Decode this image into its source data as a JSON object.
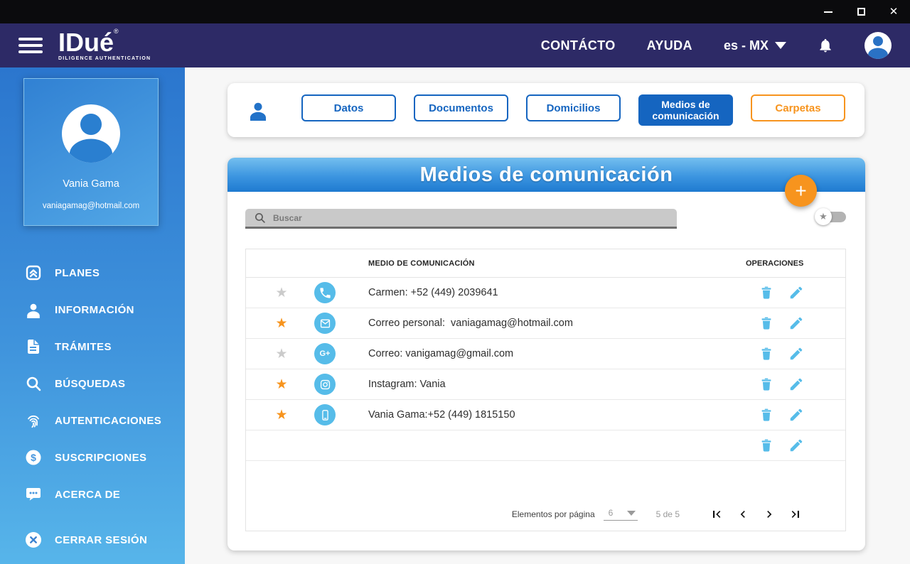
{
  "window": {
    "controls": {
      "minimize": "minimize",
      "maximize": "maximize",
      "close": "close"
    }
  },
  "navbar": {
    "logo": {
      "name": "IDué",
      "registered": "®",
      "tagline": "DILIGENCE AUTHENTICATION"
    },
    "contact_label": "CONTÁCTO",
    "help_label": "AYUDA",
    "language": "es - MX"
  },
  "sidebar": {
    "profile": {
      "name": "Vania Gama",
      "email": "vaniagamag@hotmail.com"
    },
    "items": [
      {
        "label": "PLANES",
        "icon": "plans-icon"
      },
      {
        "label": "INFORMACIÓN",
        "icon": "person-icon"
      },
      {
        "label": "TRÁMITES",
        "icon": "document-icon"
      },
      {
        "label": "BÚSQUEDAS",
        "icon": "search-icon"
      },
      {
        "label": "AUTENTICACIONES",
        "icon": "fingerprint-icon"
      },
      {
        "label": "SUSCRIPCIONES",
        "icon": "dollar-icon"
      },
      {
        "label": "ACERCA DE",
        "icon": "chat-icon"
      }
    ],
    "logout": {
      "label": "CERRAR SESIÓN",
      "icon": "logout-icon"
    }
  },
  "tabs": [
    {
      "label": "Datos",
      "variant": "outline-blue",
      "active": false
    },
    {
      "label": "Documentos",
      "variant": "outline-blue",
      "active": false
    },
    {
      "label": "Domicilios",
      "variant": "outline-blue",
      "active": false
    },
    {
      "label": "Medios de comunicación",
      "variant": "filled-blue",
      "active": true
    },
    {
      "label": "Carpetas",
      "variant": "outline-orange",
      "active": false
    }
  ],
  "panel": {
    "title": "Medios de comunicación",
    "add_button": "+",
    "search": {
      "placeholder": "Buscar"
    },
    "favorites_toggle": {
      "state": "off"
    },
    "table": {
      "column_headers": [
        "MEDIO DE COMUNICACIÓN",
        "OPERACIONES"
      ],
      "rows": [
        {
          "favorite": false,
          "type": "phone",
          "text": "Carmen: +52 (449) 2039641"
        },
        {
          "favorite": true,
          "type": "email",
          "text": "Correo personal:  vaniagamag@hotmail.com"
        },
        {
          "favorite": false,
          "type": "google-plus",
          "text": "Correo: vanigamag@gmail.com"
        },
        {
          "favorite": true,
          "type": "instagram",
          "text": "Instagram: Vania"
        },
        {
          "favorite": true,
          "type": "mobile",
          "text": "Vania Gama:+52 (449) 1815150"
        },
        {
          "favorite": null,
          "type": null,
          "text": ""
        }
      ]
    },
    "pagination": {
      "label": "Elementos por página",
      "page_size": "6",
      "range_text": "5 de 5"
    }
  },
  "colors": {
    "titlebar": "#0b0b0d",
    "navbar": "#2d2a66",
    "sidebar_top": "#2b76ce",
    "sidebar_bottom": "#57b5ea",
    "accent_blue": "#1565c0",
    "light_blue": "#56bce9",
    "orange": "#f7941e",
    "header_gradient_top": "#74bfef",
    "header_gradient_bottom": "#1e7ad0",
    "main_bg": "#f7f7f7"
  }
}
